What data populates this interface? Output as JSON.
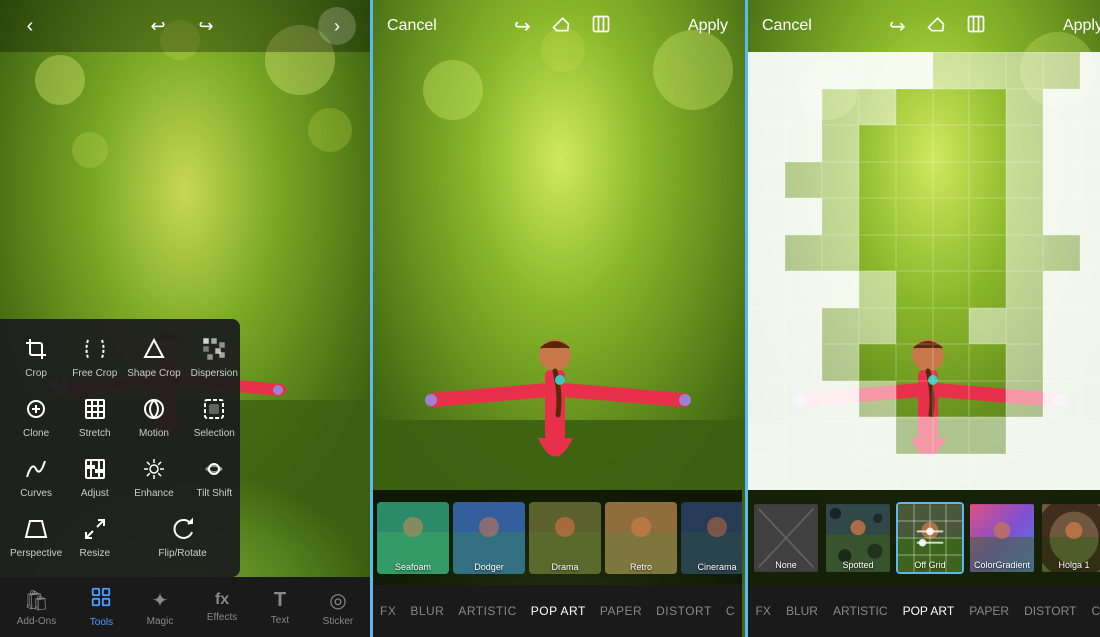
{
  "left": {
    "nav": {
      "back_label": "‹",
      "undo_icon": "↩",
      "redo_icon": "↪",
      "forward_label": "›"
    },
    "tools": [
      {
        "id": "crop",
        "icon": "⬜",
        "label": "Crop",
        "unicode": "crop"
      },
      {
        "id": "free-crop",
        "icon": "✂",
        "label": "Free Crop"
      },
      {
        "id": "shape-crop",
        "icon": "△",
        "label": "Shape Crop"
      },
      {
        "id": "dispersion",
        "icon": "⁂",
        "label": "Dispersion"
      },
      {
        "id": "clone",
        "icon": "⊕",
        "label": "Clone"
      },
      {
        "id": "stretch",
        "icon": "⊞",
        "label": "Stretch"
      },
      {
        "id": "motion",
        "icon": "⊗",
        "label": "Motion"
      },
      {
        "id": "selection",
        "icon": "◈",
        "label": "Selection"
      },
      {
        "id": "curves",
        "icon": "〜",
        "label": "Curves"
      },
      {
        "id": "adjust",
        "icon": "▣",
        "label": "Adjust"
      },
      {
        "id": "enhance",
        "icon": "✦",
        "label": "Enhance"
      },
      {
        "id": "tilt-shift",
        "icon": "◉",
        "label": "Tilt Shift"
      },
      {
        "id": "perspective",
        "icon": "⬡",
        "label": "Perspective"
      },
      {
        "id": "resize",
        "icon": "⤢",
        "label": "Resize"
      },
      {
        "id": "flip-rotate",
        "icon": "↻",
        "label": "Flip/Rotate"
      }
    ],
    "bottom_tabs": [
      {
        "id": "add-ons",
        "icon": "🛍",
        "label": "Add-Ons"
      },
      {
        "id": "tools",
        "icon": "⬡",
        "label": "Tools",
        "active": true
      },
      {
        "id": "magic",
        "icon": "✦",
        "label": "Magic"
      },
      {
        "id": "effects",
        "icon": "fx",
        "label": "Effects"
      },
      {
        "id": "text",
        "icon": "T",
        "label": "Text"
      },
      {
        "id": "sticker",
        "icon": "◎",
        "label": "Sticker"
      }
    ]
  },
  "middle": {
    "topbar": {
      "cancel": "Cancel",
      "apply": "Apply"
    },
    "filters": [
      {
        "name": "Seafoam",
        "hue": "teal"
      },
      {
        "name": "Dodger",
        "hue": "blue"
      },
      {
        "name": "Drama",
        "hue": "warm"
      },
      {
        "name": "Retro",
        "hue": "retro"
      },
      {
        "name": "Cinerama",
        "hue": "cinema"
      }
    ],
    "tabs": [
      "FX",
      "BLUR",
      "ARTISTIC",
      "POP ART",
      "PAPER",
      "DISTORT",
      "C"
    ]
  },
  "right": {
    "topbar": {
      "cancel": "Cancel",
      "apply": "Apply"
    },
    "filters": [
      {
        "name": "None",
        "selected": false
      },
      {
        "name": "Spotted",
        "selected": false
      },
      {
        "name": "Off Grid",
        "selected": true
      },
      {
        "name": "ColorGradient",
        "selected": false
      },
      {
        "name": "Holga 1",
        "selected": false
      }
    ],
    "tabs": [
      "FX",
      "BLUR",
      "ARTISTIC",
      "POP ART",
      "PAPER",
      "DISTORT",
      "CO"
    ]
  },
  "colors": {
    "accent_blue": "#5bb8f5",
    "bg_dark": "#1a1a1a",
    "white": "#ffffff",
    "text_muted": "#888888"
  }
}
